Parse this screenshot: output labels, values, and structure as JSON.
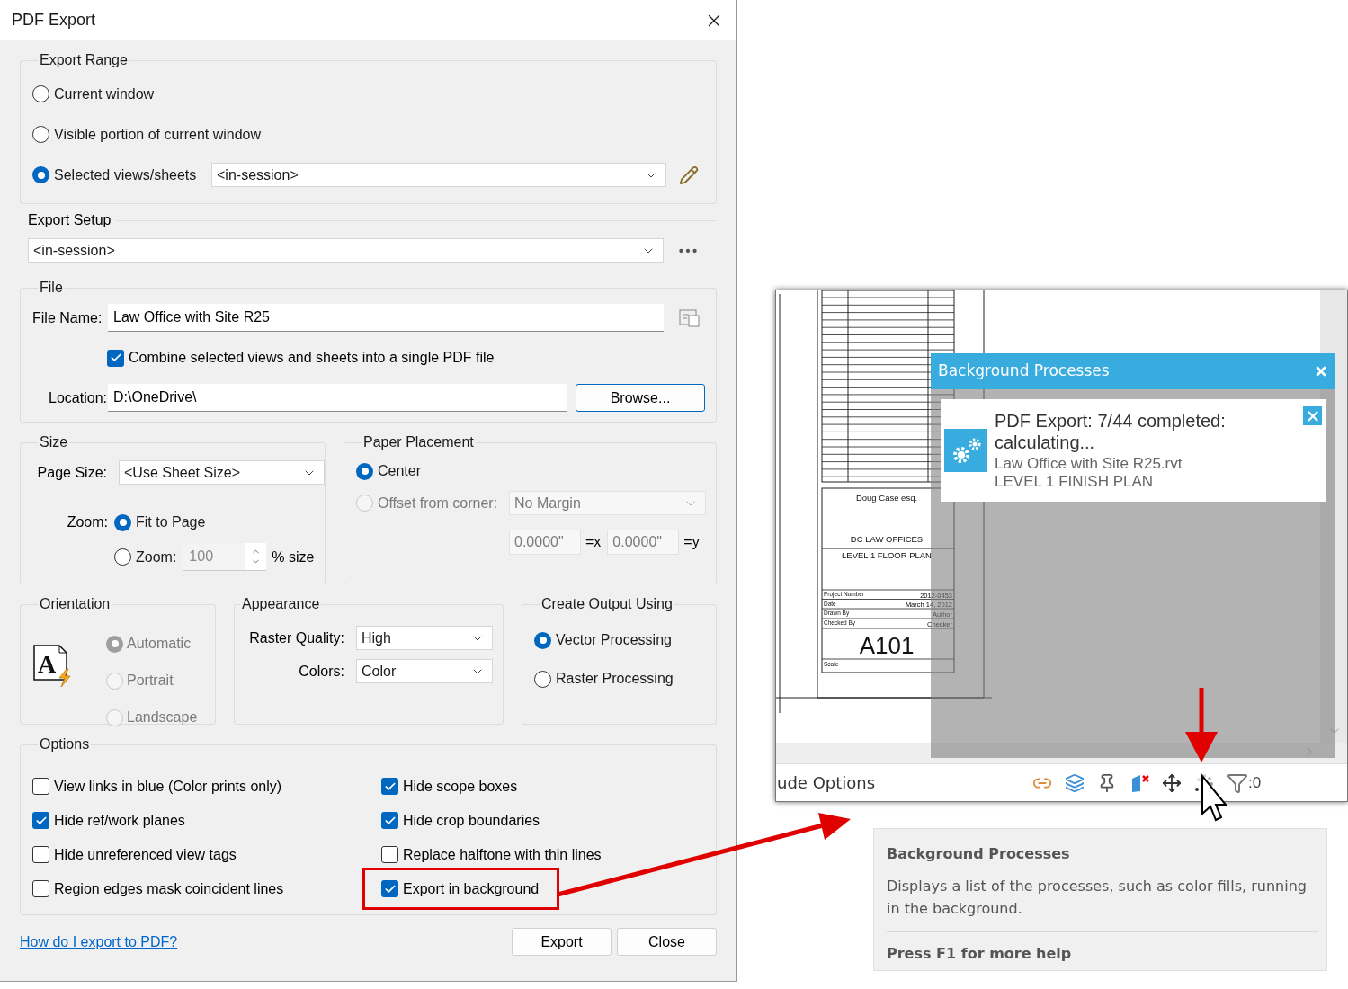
{
  "window": {
    "title": "PDF Export"
  },
  "export_range": {
    "label": "Export Range",
    "options": [
      {
        "label": "Current window",
        "selected": false
      },
      {
        "label": "Visible portion of current window",
        "selected": false
      },
      {
        "label": "Selected views/sheets",
        "selected": true
      }
    ],
    "views": "<in-session>"
  },
  "export_setup": {
    "label": "Export Setup",
    "value": "<in-session>"
  },
  "file": {
    "label": "File",
    "file_name_label": "File Name:",
    "file_name": "Law Office with Site R25",
    "combine": {
      "label": "Combine selected views and sheets into a single PDF file",
      "checked": true
    },
    "location_label": "Location:",
    "location": "D:\\OneDrive\\",
    "browse": "Browse..."
  },
  "size": {
    "label": "Size",
    "page_size_label": "Page Size:",
    "page_size": "<Use Sheet Size>",
    "zoom_label": "Zoom:",
    "options": [
      {
        "label": "Fit to Page",
        "selected": true
      },
      {
        "label": "Zoom:",
        "selected": false
      }
    ],
    "zoom_value": "100",
    "zoom_unit": "% size"
  },
  "paper_placement": {
    "label": "Paper Placement",
    "options": [
      {
        "label": "Center",
        "selected": true,
        "disabled": false
      },
      {
        "label": "Offset from corner:",
        "selected": false,
        "disabled": true
      }
    ],
    "margin": "No Margin",
    "x": "0.0000\"",
    "x_unit": "=x",
    "y": "0.0000\"",
    "y_unit": "=y"
  },
  "orientation": {
    "label": "Orientation",
    "icon_letter": "A",
    "options": [
      {
        "label": "Automatic",
        "selected": true,
        "disabled": true
      },
      {
        "label": "Portrait",
        "selected": false,
        "disabled": true
      },
      {
        "label": "Landscape",
        "selected": false,
        "disabled": true
      }
    ]
  },
  "appearance": {
    "label": "Appearance",
    "fields": [
      {
        "label": "Raster Quality:",
        "value": "High"
      },
      {
        "label": "Colors:",
        "value": "Color"
      }
    ]
  },
  "output": {
    "label": "Create Output Using",
    "options": [
      {
        "label": "Vector Processing",
        "selected": true
      },
      {
        "label": "Raster Processing",
        "selected": false
      }
    ]
  },
  "options": {
    "label": "Options",
    "items": [
      {
        "label": "View links in blue (Color prints only)",
        "checked": false,
        "highlighted": false
      },
      {
        "label": "Hide scope boxes",
        "checked": true,
        "highlighted": false
      },
      {
        "label": "Hide ref/work planes",
        "checked": true,
        "highlighted": false
      },
      {
        "label": "Hide crop boundaries",
        "checked": true,
        "highlighted": false
      },
      {
        "label": "Hide unreferenced view tags",
        "checked": false,
        "highlighted": false
      },
      {
        "label": "Replace halftone with thin lines",
        "checked": false,
        "highlighted": false
      },
      {
        "label": "Region edges mask coincident lines",
        "checked": false,
        "highlighted": false
      },
      {
        "label": "Export in background",
        "checked": true,
        "highlighted": true
      }
    ]
  },
  "help_link": "How do I export to PDF?",
  "buttons": [
    "Export",
    "Close"
  ],
  "revit": {
    "sheet": {
      "client": "Doug Case esq.",
      "project": "DC LAW OFFICES",
      "view": "LEVEL 1 FLOOR PLAN",
      "fields": [
        {
          "label": "Project Number",
          "value": "2012-0453"
        },
        {
          "label": "Date",
          "value": "March 14, 2012"
        },
        {
          "label": "Drawn By",
          "value": "Author"
        },
        {
          "label": "Checked By",
          "value": "Checker"
        }
      ],
      "number": "A101",
      "scale_label": "Scale"
    },
    "processes": {
      "title": "Background Processes",
      "items": [
        {
          "title": "PDF Export: 7/44 completed: calculating...",
          "file": "Law Office with Site R25.rvt",
          "view": "LEVEL 1 FINISH PLAN"
        }
      ]
    },
    "status_bar": {
      "label": "ude Options",
      "filter_count": ":0"
    }
  },
  "tooltip": {
    "title": "Background Processes",
    "description": "Displays a list of the processes, such as color fills, running in the background.",
    "help": "Press F1 for more help"
  }
}
